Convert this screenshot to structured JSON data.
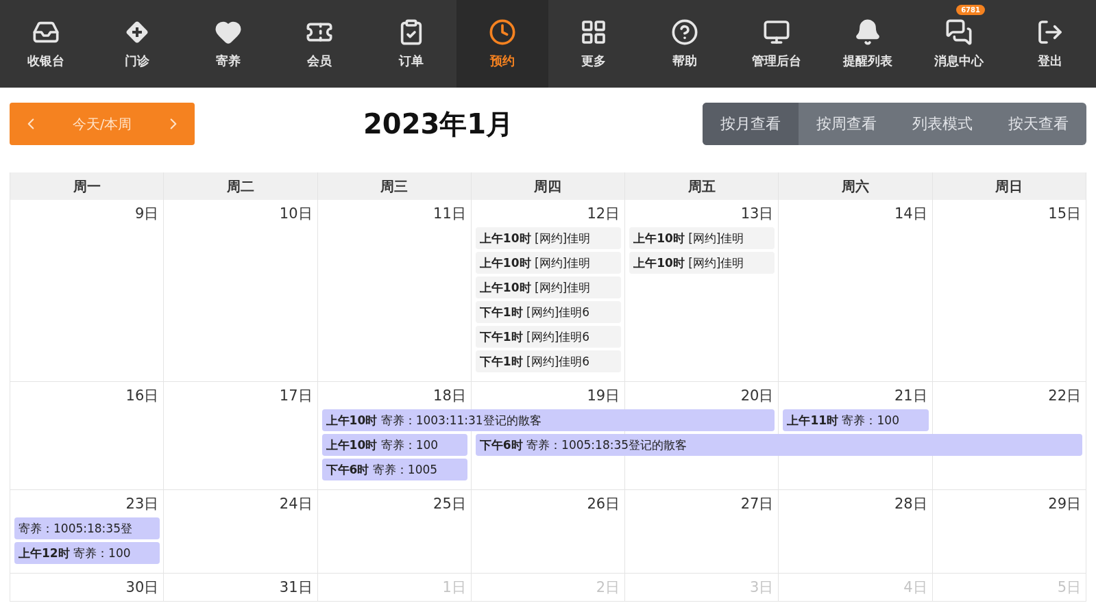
{
  "nav": {
    "items": [
      {
        "label": "收银台",
        "selected": false
      },
      {
        "label": "门诊",
        "selected": false
      },
      {
        "label": "寄养",
        "selected": false
      },
      {
        "label": "会员",
        "selected": false
      },
      {
        "label": "订单",
        "selected": false
      },
      {
        "label": "预约",
        "selected": true
      },
      {
        "label": "更多",
        "selected": false
      },
      {
        "label": "帮助",
        "selected": false
      },
      {
        "label": "管理后台",
        "selected": false
      },
      {
        "label": "提醒列表",
        "selected": false
      },
      {
        "label": "消息中心",
        "selected": false,
        "badge": "6781"
      },
      {
        "label": "登出",
        "selected": false
      }
    ]
  },
  "toolbar": {
    "today_button": "今天/本周",
    "title": "2023年1月",
    "views": [
      {
        "label": "按月查看",
        "selected": true
      },
      {
        "label": "按周查看",
        "selected": false
      },
      {
        "label": "列表模式",
        "selected": false
      },
      {
        "label": "按天查看",
        "selected": false
      }
    ]
  },
  "calendar": {
    "weekdays": [
      "周一",
      "周二",
      "周三",
      "周四",
      "周五",
      "周六",
      "周日"
    ],
    "weeks": [
      {
        "days": [
          {
            "label": "9日",
            "other_month": false
          },
          {
            "label": "10日",
            "other_month": false
          },
          {
            "label": "11日",
            "other_month": false
          },
          {
            "label": "12日",
            "other_month": false
          },
          {
            "label": "13日",
            "other_month": false
          },
          {
            "label": "14日",
            "other_month": false
          },
          {
            "label": "15日",
            "other_month": false
          }
        ],
        "event_rows": [
          [
            {
              "kind": "empty"
            },
            {
              "kind": "empty"
            },
            {
              "kind": "empty"
            },
            {
              "kind": "appointment",
              "text": "**上午10时** [网约]佳明"
            },
            {
              "kind": "appointment",
              "text": "**上午10时** [网约]佳明"
            },
            {
              "kind": "empty"
            },
            {
              "kind": "empty"
            }
          ],
          [
            {
              "kind": "empty"
            },
            {
              "kind": "empty"
            },
            {
              "kind": "empty"
            },
            {
              "kind": "appointment",
              "text": "**上午10时** [网约]佳明"
            },
            {
              "kind": "appointment",
              "text": "**上午10时** [网约]佳明"
            },
            {
              "kind": "empty"
            },
            {
              "kind": "empty"
            }
          ],
          [
            {
              "kind": "empty"
            },
            {
              "kind": "empty"
            },
            {
              "kind": "empty"
            },
            {
              "kind": "appointment",
              "text": "**上午10时** [网约]佳明"
            },
            {
              "kind": "empty"
            },
            {
              "kind": "empty"
            },
            {
              "kind": "empty"
            }
          ],
          [
            {
              "kind": "empty"
            },
            {
              "kind": "empty"
            },
            {
              "kind": "empty"
            },
            {
              "kind": "appointment",
              "text": "**下午1时** [网约]佳明6"
            },
            {
              "kind": "empty"
            },
            {
              "kind": "empty"
            },
            {
              "kind": "empty"
            }
          ],
          [
            {
              "kind": "empty"
            },
            {
              "kind": "empty"
            },
            {
              "kind": "empty"
            },
            {
              "kind": "appointment",
              "text": "**下午1时** [网约]佳明6"
            },
            {
              "kind": "empty"
            },
            {
              "kind": "empty"
            },
            {
              "kind": "empty"
            }
          ],
          [
            {
              "kind": "empty"
            },
            {
              "kind": "empty"
            },
            {
              "kind": "empty"
            },
            {
              "kind": "appointment",
              "text": "**下午1时** [网约]佳明6"
            },
            {
              "kind": "empty"
            },
            {
              "kind": "empty"
            },
            {
              "kind": "empty"
            }
          ]
        ]
      },
      {
        "days": [
          {
            "label": "16日",
            "other_month": false
          },
          {
            "label": "17日",
            "other_month": false
          },
          {
            "label": "18日",
            "other_month": false
          },
          {
            "label": "19日",
            "other_month": false
          },
          {
            "label": "20日",
            "other_month": false
          },
          {
            "label": "21日",
            "other_month": false
          },
          {
            "label": "22日",
            "other_month": false
          }
        ],
        "event_rows": [
          [
            {
              "kind": "empty"
            },
            {
              "kind": "empty"
            },
            {
              "kind": "boarding",
              "text": "**上午10时** 寄养：1003:11:31登记的散客"
            },
            {
              "kind": "span"
            },
            {
              "kind": "span"
            },
            {
              "kind": "boarding",
              "text": "**上午11时** 寄养：100"
            },
            {
              "kind": "empty"
            }
          ],
          [
            {
              "kind": "empty"
            },
            {
              "kind": "empty"
            },
            {
              "kind": "boarding",
              "text": "**上午10时** 寄养：100"
            },
            {
              "kind": "boarding",
              "text": "**下午6时** 寄养：1005:18:35登记的散客"
            },
            {
              "kind": "span"
            },
            {
              "kind": "span"
            },
            {
              "kind": "span"
            }
          ],
          [
            {
              "kind": "empty"
            },
            {
              "kind": "empty"
            },
            {
              "kind": "boarding",
              "text": "**下午6时** 寄养：1005"
            },
            {
              "kind": "empty"
            },
            {
              "kind": "empty"
            },
            {
              "kind": "empty"
            },
            {
              "kind": "empty"
            }
          ]
        ]
      },
      {
        "days": [
          {
            "label": "23日",
            "other_month": false
          },
          {
            "label": "24日",
            "other_month": false
          },
          {
            "label": "25日",
            "other_month": false
          },
          {
            "label": "26日",
            "other_month": false
          },
          {
            "label": "27日",
            "other_month": false
          },
          {
            "label": "28日",
            "other_month": false
          },
          {
            "label": "29日",
            "other_month": false
          }
        ],
        "event_rows": [
          [
            {
              "kind": "boarding",
              "text": "寄养：1005:18:35登"
            },
            {
              "kind": "empty"
            },
            {
              "kind": "empty"
            },
            {
              "kind": "empty"
            },
            {
              "kind": "empty"
            },
            {
              "kind": "empty"
            },
            {
              "kind": "empty"
            }
          ],
          [
            {
              "kind": "boarding",
              "text": "**上午12时** 寄养：100"
            },
            {
              "kind": "empty"
            },
            {
              "kind": "empty"
            },
            {
              "kind": "empty"
            },
            {
              "kind": "empty"
            },
            {
              "kind": "empty"
            },
            {
              "kind": "empty"
            }
          ]
        ]
      },
      {
        "days": [
          {
            "label": "30日",
            "other_month": false
          },
          {
            "label": "31日",
            "other_month": false
          },
          {
            "label": "1日",
            "other_month": true
          },
          {
            "label": "2日",
            "other_month": true
          },
          {
            "label": "3日",
            "other_month": true
          },
          {
            "label": "4日",
            "other_month": true
          },
          {
            "label": "5日",
            "other_month": true
          }
        ]
      }
    ]
  }
}
